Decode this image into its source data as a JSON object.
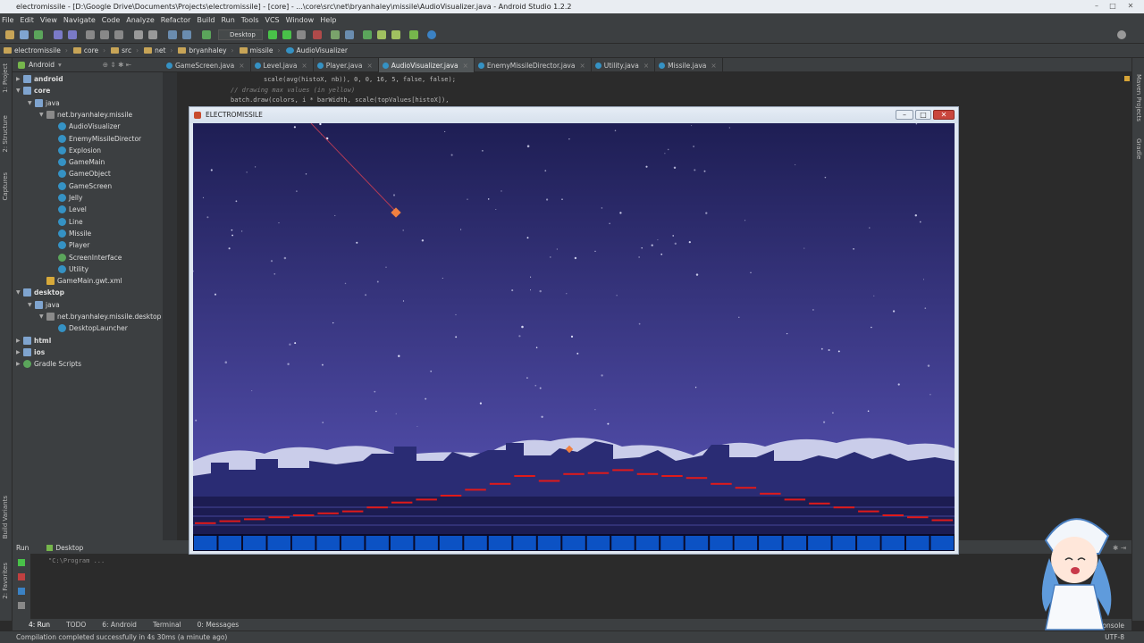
{
  "window": {
    "title": "electromissile - [D:\\Google Drive\\Documents\\Projects\\electromissile] - [core] - ...\\core\\src\\net\\bryanhaley\\missile\\AudioVisualizer.java - Android Studio 1.2.2"
  },
  "menu": [
    "File",
    "Edit",
    "View",
    "Navigate",
    "Code",
    "Analyze",
    "Refactor",
    "Build",
    "Run",
    "Tools",
    "VCS",
    "Window",
    "Help"
  ],
  "toolbar": {
    "run_config": "Desktop"
  },
  "breadcrumbs": [
    "electromissile",
    "core",
    "src",
    "net",
    "bryanhaley",
    "missile",
    "AudioVisualizer"
  ],
  "project": {
    "view_mode": "Android",
    "tree": [
      {
        "label": "android",
        "icon": "folder-icon",
        "depth": 0,
        "expanded": false,
        "bold": true
      },
      {
        "label": "core",
        "icon": "folder-icon",
        "depth": 0,
        "expanded": true,
        "bold": true
      },
      {
        "label": "java",
        "icon": "folder-icon",
        "depth": 1,
        "expanded": true
      },
      {
        "label": "net.bryanhaley.missile",
        "icon": "package-icon",
        "depth": 2,
        "expanded": true
      },
      {
        "label": "AudioVisualizer",
        "icon": "class-icon",
        "depth": 3
      },
      {
        "label": "EnemyMissileDirector",
        "icon": "class-icon",
        "depth": 3
      },
      {
        "label": "Explosion",
        "icon": "class-icon",
        "depth": 3
      },
      {
        "label": "GameMain",
        "icon": "class-icon",
        "depth": 3
      },
      {
        "label": "GameObject",
        "icon": "class-icon",
        "depth": 3
      },
      {
        "label": "GameScreen",
        "icon": "class-icon",
        "depth": 3
      },
      {
        "label": "Jelly",
        "icon": "class-icon",
        "depth": 3
      },
      {
        "label": "Level",
        "icon": "class-icon",
        "depth": 3
      },
      {
        "label": "Line",
        "icon": "class-icon",
        "depth": 3
      },
      {
        "label": "Missile",
        "icon": "class-icon",
        "depth": 3
      },
      {
        "label": "Player",
        "icon": "class-icon",
        "depth": 3
      },
      {
        "label": "ScreenInterface",
        "icon": "interface-icon",
        "depth": 3
      },
      {
        "label": "Utility",
        "icon": "class-icon",
        "depth": 3
      },
      {
        "label": "GameMain.gwt.xml",
        "icon": "xml-icon",
        "depth": 2
      },
      {
        "label": "desktop",
        "icon": "folder-icon",
        "depth": 0,
        "expanded": true,
        "bold": true
      },
      {
        "label": "java",
        "icon": "folder-icon",
        "depth": 1,
        "expanded": true
      },
      {
        "label": "net.bryanhaley.missile.desktop",
        "icon": "package-icon",
        "depth": 2,
        "expanded": true
      },
      {
        "label": "DesktopLauncher",
        "icon": "class-icon",
        "depth": 3
      },
      {
        "label": "html",
        "icon": "folder-icon",
        "depth": 0,
        "expanded": false,
        "bold": true
      },
      {
        "label": "ios",
        "icon": "folder-icon",
        "depth": 0,
        "expanded": false,
        "bold": true
      },
      {
        "label": "Gradle Scripts",
        "icon": "gradle-icon",
        "depth": 0,
        "expanded": false
      }
    ]
  },
  "left_strip": [
    "1: Project",
    "2: Structure",
    "Captures",
    "Build Variants",
    "2: Favorites"
  ],
  "right_strip": [
    "Maven Projects",
    "Gradle"
  ],
  "tabs": [
    {
      "label": "GameScreen.java",
      "active": false
    },
    {
      "label": "Level.java",
      "active": false
    },
    {
      "label": "Player.java",
      "active": false
    },
    {
      "label": "AudioVisualizer.java",
      "active": true
    },
    {
      "label": "EnemyMissileDirector.java",
      "active": false
    },
    {
      "label": "Utility.java",
      "active": false
    },
    {
      "label": "Missile.java",
      "active": false
    }
  ],
  "code": [
    "scale(avg(histoX, nb)), 0, 0, 16, 5, false, false);",
    "// drawing max values (in yellow)",
    "batch.draw(colors, i * barWidth, scale(topValues[histoX]),"
  ],
  "game": {
    "title": "ELECTROMISSILE",
    "colors": {
      "sky_top": "#1e1e54",
      "sky_bottom": "#5a55b9",
      "bars": "#0c52c4",
      "levels": "#e01a1a",
      "missile": "#f08040"
    },
    "level_bars": [
      0.12,
      0.14,
      0.16,
      0.18,
      0.2,
      0.22,
      0.24,
      0.28,
      0.33,
      0.36,
      0.4,
      0.46,
      0.52,
      0.6,
      0.55,
      0.62,
      0.63,
      0.66,
      0.62,
      0.6,
      0.58,
      0.52,
      0.48,
      0.42,
      0.36,
      0.32,
      0.28,
      0.24,
      0.2,
      0.18,
      0.15
    ]
  },
  "run_panel": {
    "label": "Run",
    "config": "Desktop",
    "output": "\"C:\\Program ..."
  },
  "tool_windows": [
    "4: Run",
    "TODO",
    "6: Android",
    "Terminal",
    "0: Messages"
  ],
  "status": {
    "message": "Compilation completed successfully in 4s 30ms (a minute ago)",
    "right": "Gradle Console",
    "encoding": "UTF-8"
  }
}
